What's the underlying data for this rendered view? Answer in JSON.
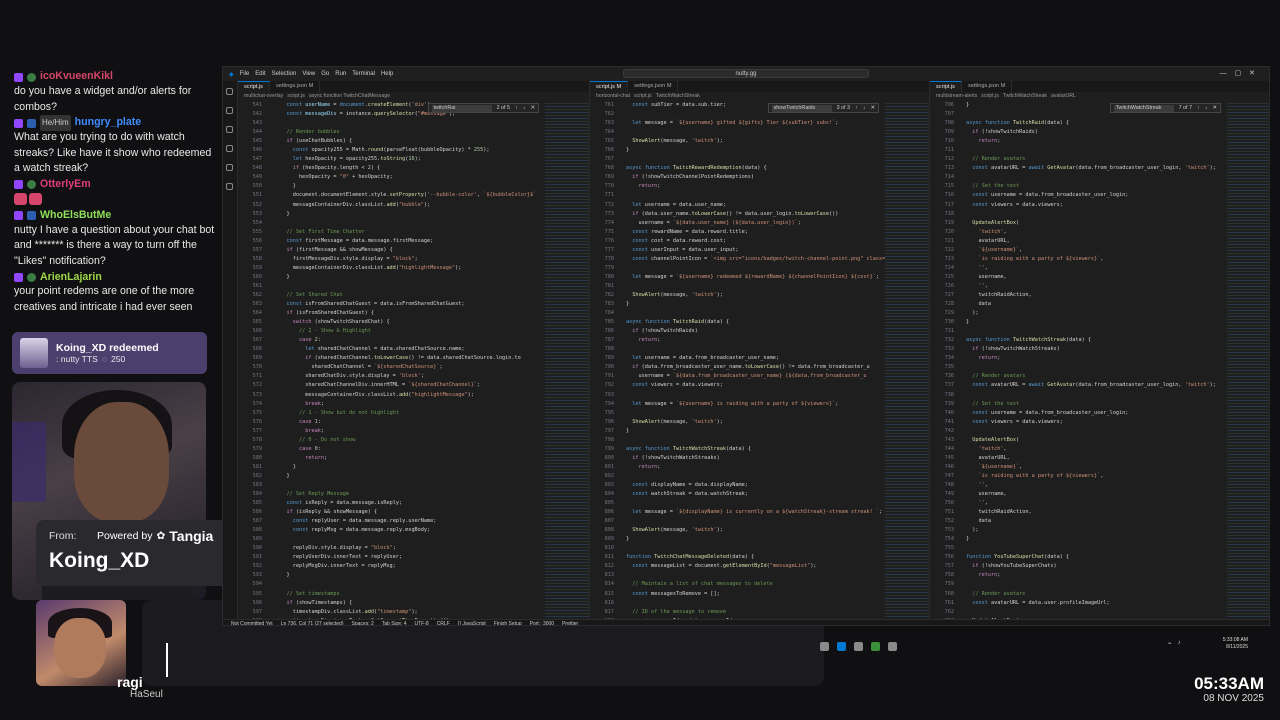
{
  "chat": {
    "messages": [
      {
        "user": "icoKvueenKikl",
        "color": "#d6456c",
        "pronoun": "",
        "text": "do you have a widget and/or alerts for combos?"
      },
      {
        "user": "hungry_plate",
        "color": "#3f8cff",
        "pronoun": "He/Him",
        "text": "What are you trying to do with watch streaks? Like have it show who redeemed a watch streak?"
      },
      {
        "user": "OtterlyEm",
        "color": "#e0407a",
        "pronoun": "",
        "text": ""
      },
      {
        "user": "WhoElsButMe",
        "color": "#8fe05a",
        "pronoun": "",
        "text": "nutty I have a question about your chat bot and ******* is there a way to turn off the \"Likes\" notification?"
      },
      {
        "user": "ArienLajarin",
        "color": "#9fd648",
        "pronoun": "",
        "text": "your point redems are one of the more creatives and intricate i had ever seen"
      }
    ]
  },
  "redeem": {
    "title": "Koing_XD redeemed",
    "reward": ": nutty TTS",
    "cost": "250"
  },
  "from_panel": {
    "label": "From:",
    "powered_by": "Powered by",
    "brand": "Tangia",
    "user": "Koing_XD"
  },
  "cam2": {
    "name": "ragi",
    "sub": "HaSeul"
  },
  "clock": {
    "time": "05:33AM",
    "date": "08 NOV 2025"
  },
  "vscode": {
    "menu": [
      "File",
      "Edit",
      "Selection",
      "View",
      "Go",
      "Run",
      "Terminal",
      "Help"
    ],
    "search": "nutty.gg",
    "panes": [
      {
        "tabs": [
          "script.js",
          "settings.json M"
        ],
        "crumb": [
          "multichat-overlay",
          "script.js",
          "async function TwitchChatMessage"
        ],
        "find": "twitchRai",
        "find_count": "2 of 5"
      },
      {
        "tabs": [
          "script.js M",
          "settings.json M"
        ],
        "crumb": [
          "horizontal-chat",
          "script.js",
          "TwitchWatchStreak"
        ],
        "find": "showTwitchRaids",
        "find_count": "3 of 3"
      },
      {
        "tabs": [
          "script.js",
          "settings.json M"
        ],
        "crumb": [
          "multistream-alerts",
          "script.js",
          "TwitchWatchStreak",
          "avatarURL"
        ],
        "find": "TwitchWatchStreak",
        "find_count": "7 of 7"
      }
    ],
    "status": [
      "Not Committed Yet",
      "Ln 736, Col 71 (27 selected)",
      "Spaces: 2",
      "Tab Size: 4",
      "UTF-8",
      "CRLF",
      "{} JavaScript",
      "Finish Setup",
      "Port : 3000",
      "Prettier"
    ],
    "tray_time": "5:33:08 AM",
    "tray_date": "8/11/2025"
  }
}
